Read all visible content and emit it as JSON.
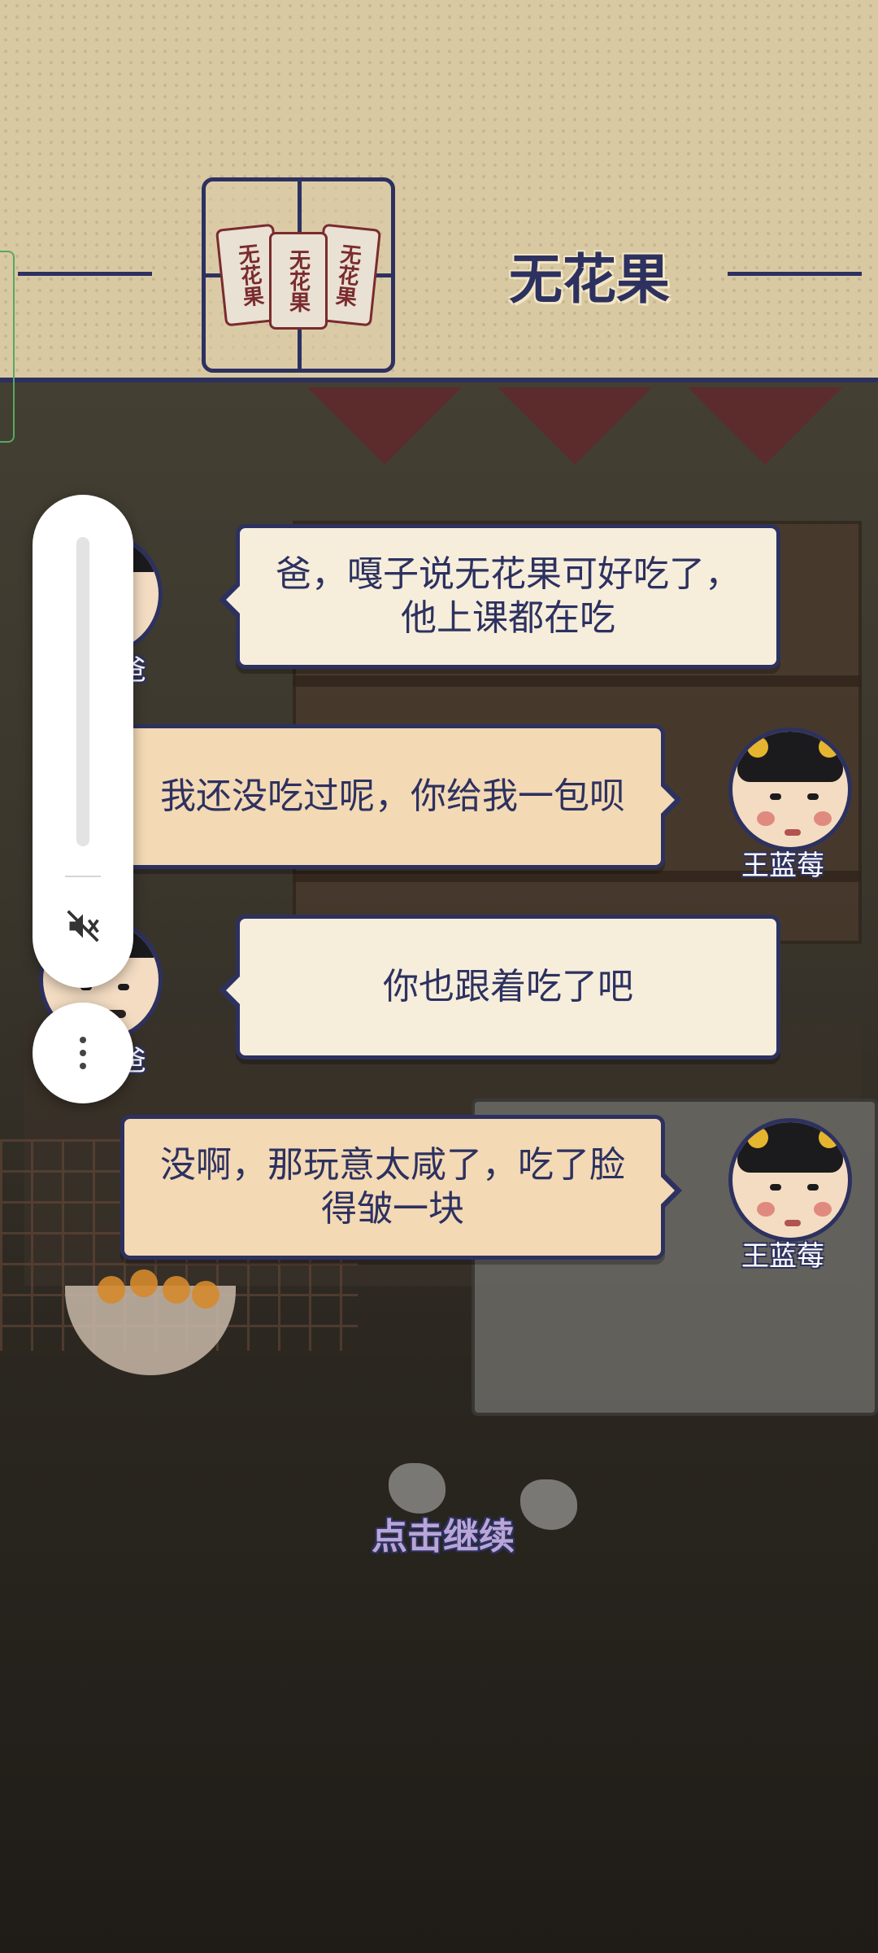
{
  "header": {
    "item_name": "无花果",
    "bag_label": "无花果"
  },
  "dialogue": [
    {
      "speaker": "爸",
      "side": "parent",
      "text": "爸，嘎子说无花果可好吃了，他上课都在吃"
    },
    {
      "speaker": "王蓝莓",
      "side": "child",
      "text": "我还没吃过呢，你给我一包呗"
    },
    {
      "speaker": "爸",
      "side": "parent",
      "text": "你也跟着吃了吧"
    },
    {
      "speaker": "王蓝莓",
      "side": "child",
      "text": "没啊，那玩意太咸了，吃了脸得皱一块"
    }
  ],
  "characters": {
    "child_name": "王蓝莓",
    "parent_name_partial": "爸"
  },
  "prompt": {
    "continue_label": "点击继续"
  },
  "volume_overlay": {
    "state": "muted",
    "icon": "volume-off-icon",
    "more_icon": "more-vertical-icon"
  },
  "colors": {
    "navy_outline": "#2d3160",
    "parchment": "#d8c9a3",
    "bubble_light": "#f6eedb",
    "bubble_warm": "#f3d9b4",
    "continue_text": "#b9a6d6"
  }
}
